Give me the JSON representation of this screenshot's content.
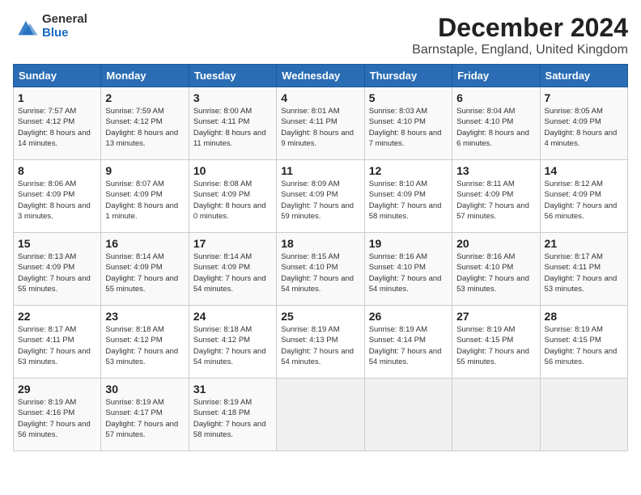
{
  "logo": {
    "general": "General",
    "blue": "Blue"
  },
  "title": "December 2024",
  "location": "Barnstaple, England, United Kingdom",
  "weekdays": [
    "Sunday",
    "Monday",
    "Tuesday",
    "Wednesday",
    "Thursday",
    "Friday",
    "Saturday"
  ],
  "weeks": [
    [
      {
        "day": "1",
        "sunrise": "7:57 AM",
        "sunset": "4:12 PM",
        "daylight": "8 hours and 14 minutes."
      },
      {
        "day": "2",
        "sunrise": "7:59 AM",
        "sunset": "4:12 PM",
        "daylight": "8 hours and 13 minutes."
      },
      {
        "day": "3",
        "sunrise": "8:00 AM",
        "sunset": "4:11 PM",
        "daylight": "8 hours and 11 minutes."
      },
      {
        "day": "4",
        "sunrise": "8:01 AM",
        "sunset": "4:11 PM",
        "daylight": "8 hours and 9 minutes."
      },
      {
        "day": "5",
        "sunrise": "8:03 AM",
        "sunset": "4:10 PM",
        "daylight": "8 hours and 7 minutes."
      },
      {
        "day": "6",
        "sunrise": "8:04 AM",
        "sunset": "4:10 PM",
        "daylight": "8 hours and 6 minutes."
      },
      {
        "day": "7",
        "sunrise": "8:05 AM",
        "sunset": "4:09 PM",
        "daylight": "8 hours and 4 minutes."
      }
    ],
    [
      {
        "day": "8",
        "sunrise": "8:06 AM",
        "sunset": "4:09 PM",
        "daylight": "8 hours and 3 minutes."
      },
      {
        "day": "9",
        "sunrise": "8:07 AM",
        "sunset": "4:09 PM",
        "daylight": "8 hours and 1 minute."
      },
      {
        "day": "10",
        "sunrise": "8:08 AM",
        "sunset": "4:09 PM",
        "daylight": "8 hours and 0 minutes."
      },
      {
        "day": "11",
        "sunrise": "8:09 AM",
        "sunset": "4:09 PM",
        "daylight": "7 hours and 59 minutes."
      },
      {
        "day": "12",
        "sunrise": "8:10 AM",
        "sunset": "4:09 PM",
        "daylight": "7 hours and 58 minutes."
      },
      {
        "day": "13",
        "sunrise": "8:11 AM",
        "sunset": "4:09 PM",
        "daylight": "7 hours and 57 minutes."
      },
      {
        "day": "14",
        "sunrise": "8:12 AM",
        "sunset": "4:09 PM",
        "daylight": "7 hours and 56 minutes."
      }
    ],
    [
      {
        "day": "15",
        "sunrise": "8:13 AM",
        "sunset": "4:09 PM",
        "daylight": "7 hours and 55 minutes."
      },
      {
        "day": "16",
        "sunrise": "8:14 AM",
        "sunset": "4:09 PM",
        "daylight": "7 hours and 55 minutes."
      },
      {
        "day": "17",
        "sunrise": "8:14 AM",
        "sunset": "4:09 PM",
        "daylight": "7 hours and 54 minutes."
      },
      {
        "day": "18",
        "sunrise": "8:15 AM",
        "sunset": "4:10 PM",
        "daylight": "7 hours and 54 minutes."
      },
      {
        "day": "19",
        "sunrise": "8:16 AM",
        "sunset": "4:10 PM",
        "daylight": "7 hours and 54 minutes."
      },
      {
        "day": "20",
        "sunrise": "8:16 AM",
        "sunset": "4:10 PM",
        "daylight": "7 hours and 53 minutes."
      },
      {
        "day": "21",
        "sunrise": "8:17 AM",
        "sunset": "4:11 PM",
        "daylight": "7 hours and 53 minutes."
      }
    ],
    [
      {
        "day": "22",
        "sunrise": "8:17 AM",
        "sunset": "4:11 PM",
        "daylight": "7 hours and 53 minutes."
      },
      {
        "day": "23",
        "sunrise": "8:18 AM",
        "sunset": "4:12 PM",
        "daylight": "7 hours and 53 minutes."
      },
      {
        "day": "24",
        "sunrise": "8:18 AM",
        "sunset": "4:12 PM",
        "daylight": "7 hours and 54 minutes."
      },
      {
        "day": "25",
        "sunrise": "8:19 AM",
        "sunset": "4:13 PM",
        "daylight": "7 hours and 54 minutes."
      },
      {
        "day": "26",
        "sunrise": "8:19 AM",
        "sunset": "4:14 PM",
        "daylight": "7 hours and 54 minutes."
      },
      {
        "day": "27",
        "sunrise": "8:19 AM",
        "sunset": "4:15 PM",
        "daylight": "7 hours and 55 minutes."
      },
      {
        "day": "28",
        "sunrise": "8:19 AM",
        "sunset": "4:15 PM",
        "daylight": "7 hours and 56 minutes."
      }
    ],
    [
      {
        "day": "29",
        "sunrise": "8:19 AM",
        "sunset": "4:16 PM",
        "daylight": "7 hours and 56 minutes."
      },
      {
        "day": "30",
        "sunrise": "8:19 AM",
        "sunset": "4:17 PM",
        "daylight": "7 hours and 57 minutes."
      },
      {
        "day": "31",
        "sunrise": "8:19 AM",
        "sunset": "4:18 PM",
        "daylight": "7 hours and 58 minutes."
      },
      null,
      null,
      null,
      null
    ]
  ],
  "labels": {
    "sunrise": "Sunrise:",
    "sunset": "Sunset:",
    "daylight": "Daylight:"
  }
}
